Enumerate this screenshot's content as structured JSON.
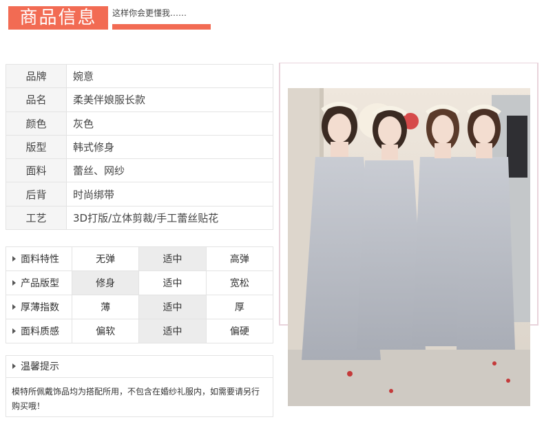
{
  "header": {
    "title": "商品信息",
    "subtitle": "这样你会更懂我……",
    "accent_color": "#f26b53"
  },
  "info_rows": [
    {
      "label": "品牌",
      "value": "婉意"
    },
    {
      "label": "品名",
      "value": "柔美伴娘服长款"
    },
    {
      "label": "颜色",
      "value": "灰色"
    },
    {
      "label": "版型",
      "value": "韩式修身"
    },
    {
      "label": "面料",
      "value": "蕾丝、网纱"
    },
    {
      "label": "后背",
      "value": "时尚绑带"
    },
    {
      "label": "工艺",
      "value": "3D打版/立体剪裁/手工蕾丝贴花"
    }
  ],
  "attributes": [
    {
      "label": "面料特性",
      "options": [
        "无弹",
        "适中",
        "高弹"
      ],
      "selected": 1
    },
    {
      "label": "产品版型",
      "options": [
        "修身",
        "适中",
        "宽松"
      ],
      "selected": 0
    },
    {
      "label": "厚薄指数",
      "options": [
        "薄",
        "适中",
        "厚"
      ],
      "selected": 1
    },
    {
      "label": "面料质感",
      "options": [
        "偏软",
        "适中",
        "偏硬"
      ],
      "selected": 1
    }
  ],
  "tips": {
    "title": "温馨提示",
    "text": "模特所佩戴饰品均为搭配所用，不包含在婚纱礼服内，如需要请另行购买哦！"
  },
  "photo": {
    "subject": "four-bridesmaids-grey-gowns",
    "dress_color": "#b9bcc3",
    "wall_color": "#e9e2d8"
  }
}
